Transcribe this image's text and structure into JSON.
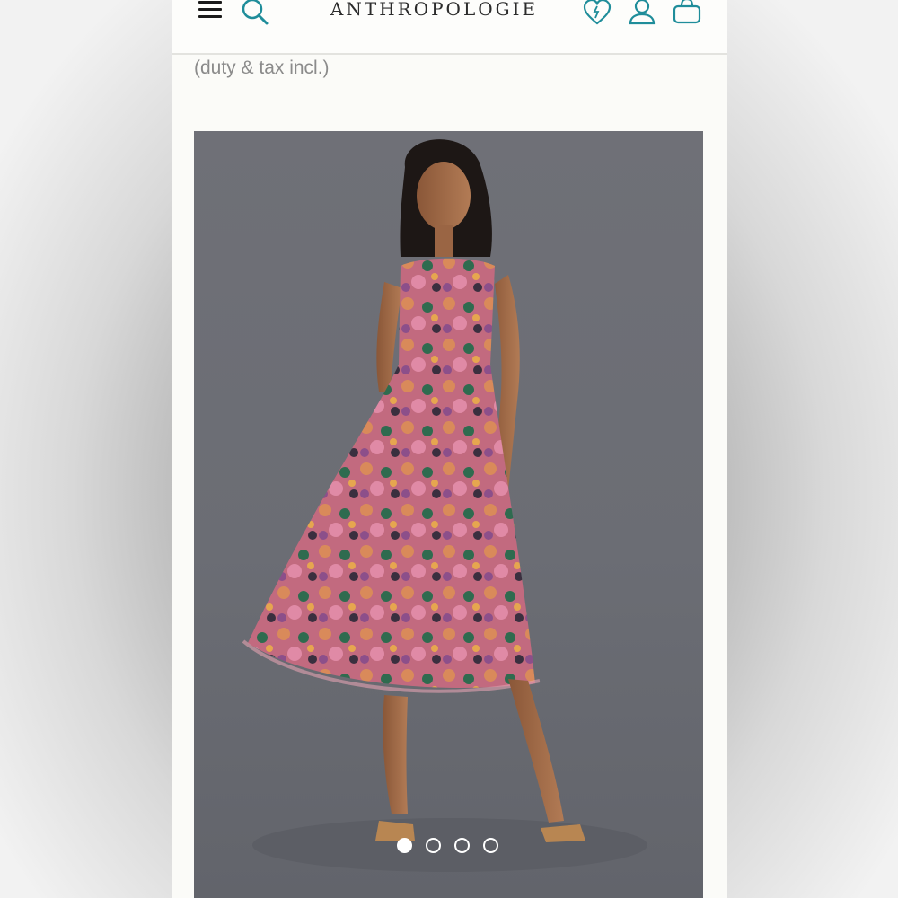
{
  "header": {
    "logo_text": "ANTHROPOLOGIE",
    "icons": {
      "menu": "menu-icon",
      "search": "search-icon",
      "wishlist": "heart-icon",
      "account": "person-icon",
      "bag": "shopping-bag-icon"
    }
  },
  "product": {
    "price_note": "(duty & tax incl.)"
  },
  "gallery": {
    "image_count": 4,
    "active_index": 0
  },
  "colors": {
    "accent": "#1f8d9a",
    "page_background": "#fbfbf8",
    "photo_background": "#6e7076",
    "dress_pink": "#c46b86"
  }
}
